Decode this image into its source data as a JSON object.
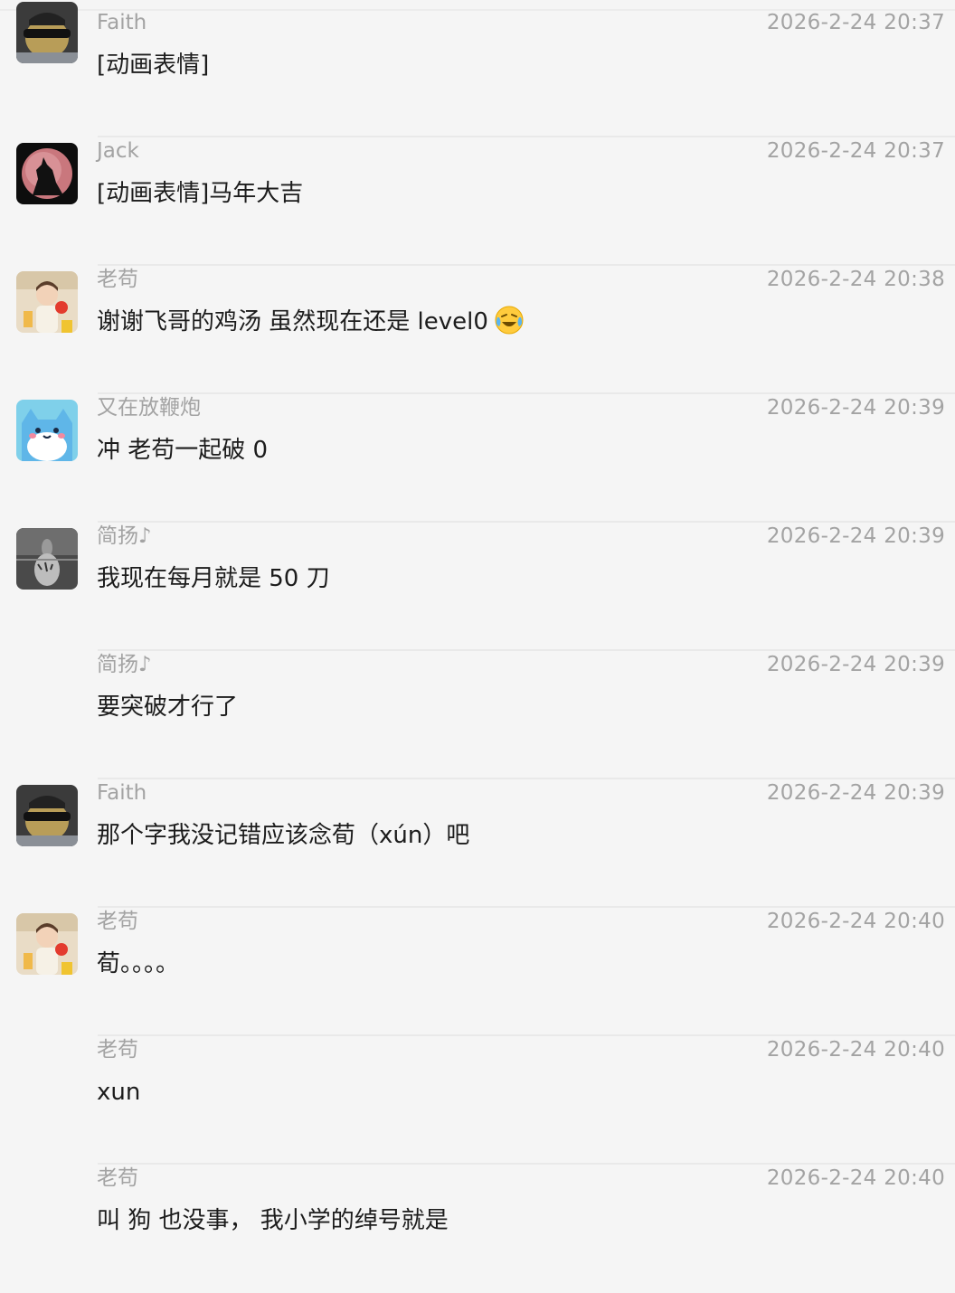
{
  "messages": [
    {
      "sender": "Faith",
      "time": "2026-2-24 20:37",
      "text": "[动画表情]",
      "avatar": "avatar-faith"
    },
    {
      "sender": "Jack",
      "time": "2026-2-24 20:37",
      "text": "[动画表情]马年大吉",
      "avatar": "avatar-jack"
    },
    {
      "sender": "老苟",
      "time": "2026-2-24 20:38",
      "text": "谢谢飞哥的鸡汤 虽然现在还是 level0",
      "emoji": "laughing-crying-emoji",
      "avatar": "avatar-laogou"
    },
    {
      "sender": "又在放鞭炮",
      "time": "2026-2-24 20:39",
      "text": "冲 老苟一起破 0",
      "avatar": "avatar-cat"
    },
    {
      "sender": "简扬♪",
      "time": "2026-2-24 20:39",
      "text": "我现在每月就是 50 刀",
      "avatar": "avatar-jianyang"
    },
    {
      "sender": "简扬♪",
      "time": "2026-2-24 20:39",
      "text": "要突破才行了"
    },
    {
      "sender": "Faith",
      "time": "2026-2-24 20:39",
      "text": "那个字我没记错应该念荀（xún）吧",
      "avatar": "avatar-faith"
    },
    {
      "sender": "老苟",
      "time": "2026-2-24 20:40",
      "text": "荀。。。。",
      "avatar": "avatar-laogou"
    },
    {
      "sender": "老苟",
      "time": "2026-2-24 20:40",
      "text": "xun"
    },
    {
      "sender": "老苟",
      "time": "2026-2-24 20:40",
      "text": "叫 狗 也没事， 我小学的绰号就是"
    }
  ]
}
